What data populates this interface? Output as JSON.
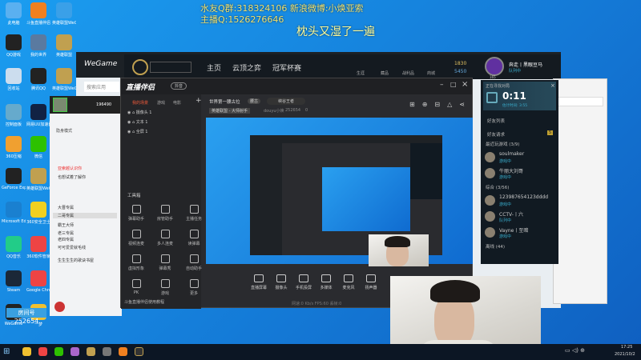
{
  "overlay": {
    "line1": "水友Q群:318324106 新浪微博:小焕亚索",
    "line2": "主播Q:1526276646",
    "caption": "枕头又湿了一遍"
  },
  "desktop_icons": [
    {
      "label": "此电脑",
      "color": "#5ab0f0"
    },
    {
      "label": "斗鱼直播伴侣",
      "color": "#f08020"
    },
    {
      "label": "英雄联盟WeGame版",
      "color": "#3aa0e8"
    },
    {
      "label": "QQ游戏",
      "color": "#222"
    },
    {
      "label": "我的世界",
      "color": "#5a7aa0"
    },
    {
      "label": "英雄联盟",
      "color": "#c0a050"
    },
    {
      "label": "回收站",
      "color": "#cde"
    },
    {
      "label": "腾讯QQ",
      "color": "#222"
    },
    {
      "label": "英雄联盟WeGame版",
      "color": "#c0a050"
    },
    {
      "label": "控制面板",
      "color": "#6ac"
    },
    {
      "label": "网易UU加速器",
      "color": "#124"
    },
    {
      "label": "360压缩",
      "color": "#f0a030"
    },
    {
      "label": "微信",
      "color": "#2dc100"
    },
    {
      "label": "GeForce Experience",
      "color": "#222"
    },
    {
      "label": "英雄联盟WeGame版",
      "color": "#c0a050"
    },
    {
      "label": "Microsoft Edge",
      "color": "#1a80d0"
    },
    {
      "label": "360安全卫士",
      "color": "#f0d020"
    },
    {
      "label": "QQ音乐",
      "color": "#2c8"
    },
    {
      "label": "360软件管家",
      "color": "#e44"
    },
    {
      "label": "Steam",
      "color": "#1b2838"
    },
    {
      "label": "Google Chrome",
      "color": "#e44"
    },
    {
      "label": "WeGame",
      "color": "#222"
    },
    {
      "label": "一梦",
      "color": "#f0c030"
    }
  ],
  "room": {
    "label": "房间号",
    "number": "252654"
  },
  "wegame": {
    "logo": "WeGame",
    "search_placeholder": "搜索应用"
  },
  "lol_client": {
    "nav": [
      "主页",
      "云顶之弈",
      "冠军杯赛"
    ],
    "icons": [
      "生涯",
      "藏品",
      "战利品",
      "商城"
    ],
    "currency": [
      "1830",
      "5450"
    ],
    "player": "奔走丨黑眼豆马",
    "status": "队列中",
    "level": "165"
  },
  "live": {
    "app_name": "直播伴侣",
    "version_badge": "抖音",
    "scene_tabs": [
      "我的场景",
      "游戏",
      "电影"
    ],
    "sources": [
      "摄像头 1",
      "文本 1",
      "全屏 1"
    ],
    "room_title": "世界第一腰古拉",
    "tag": "腰古",
    "edit": "峡谷王者",
    "category": "英雄联盟 - 大师射手",
    "host": "douyu小焕",
    "room_id": "252654",
    "hot": "0",
    "toolbox_title": "工具箱",
    "tools": [
      "弹幕助手",
      "房管助手",
      "主播任务",
      "视频连麦",
      "多人连麦",
      "读弹幕",
      "虚拟形象",
      "弹幕秀",
      "自动助手",
      "PK",
      "游戏",
      "更多"
    ],
    "bottom": [
      "直播屏幕",
      "摄像头",
      "手机投屏",
      "多媒体",
      "麦克风",
      "扬声器"
    ],
    "status": "网速:0 Kb/s  FPS:60  丢帧:0",
    "tip": "斗鱼直播伴侣使用教程"
  },
  "friends": {
    "match_title": "正在寻找对局",
    "timer": "0:11",
    "estimate": "估计时间: 3:55",
    "list_title": "好友列表",
    "requests": "好友请求",
    "request_count": "5",
    "groups": [
      {
        "name": "最近玩游戏 (3/9)",
        "members": [
          {
            "name": "soulmaker",
            "status": "游戏中"
          },
          {
            "name": "牛丽大刘哥",
            "status": "游戏中"
          }
        ]
      },
      {
        "name": "综合 (3/56)",
        "members": [
          {
            "name": "123987654123dddd",
            "status": "游戏中"
          },
          {
            "name": "CCTV-丨六",
            "status": "队列中"
          },
          {
            "name": "Vayne丨至暗",
            "status": "游戏中"
          }
        ]
      },
      {
        "name": "离线 (44)",
        "members": []
      }
    ]
  },
  "qq": {
    "id": "196490",
    "mode": "隐身模式",
    "rows": [
      "亚索越认识你",
      "也想试着了解你",
      "大晋专属",
      "二哥专属",
      "霸王大师",
      "老三专属",
      "老四专属",
      "可可爱爱就毛线",
      "生生生生的歌诀书屋"
    ]
  },
  "clock": {
    "time": "17:25",
    "date": "2021/10/2"
  }
}
